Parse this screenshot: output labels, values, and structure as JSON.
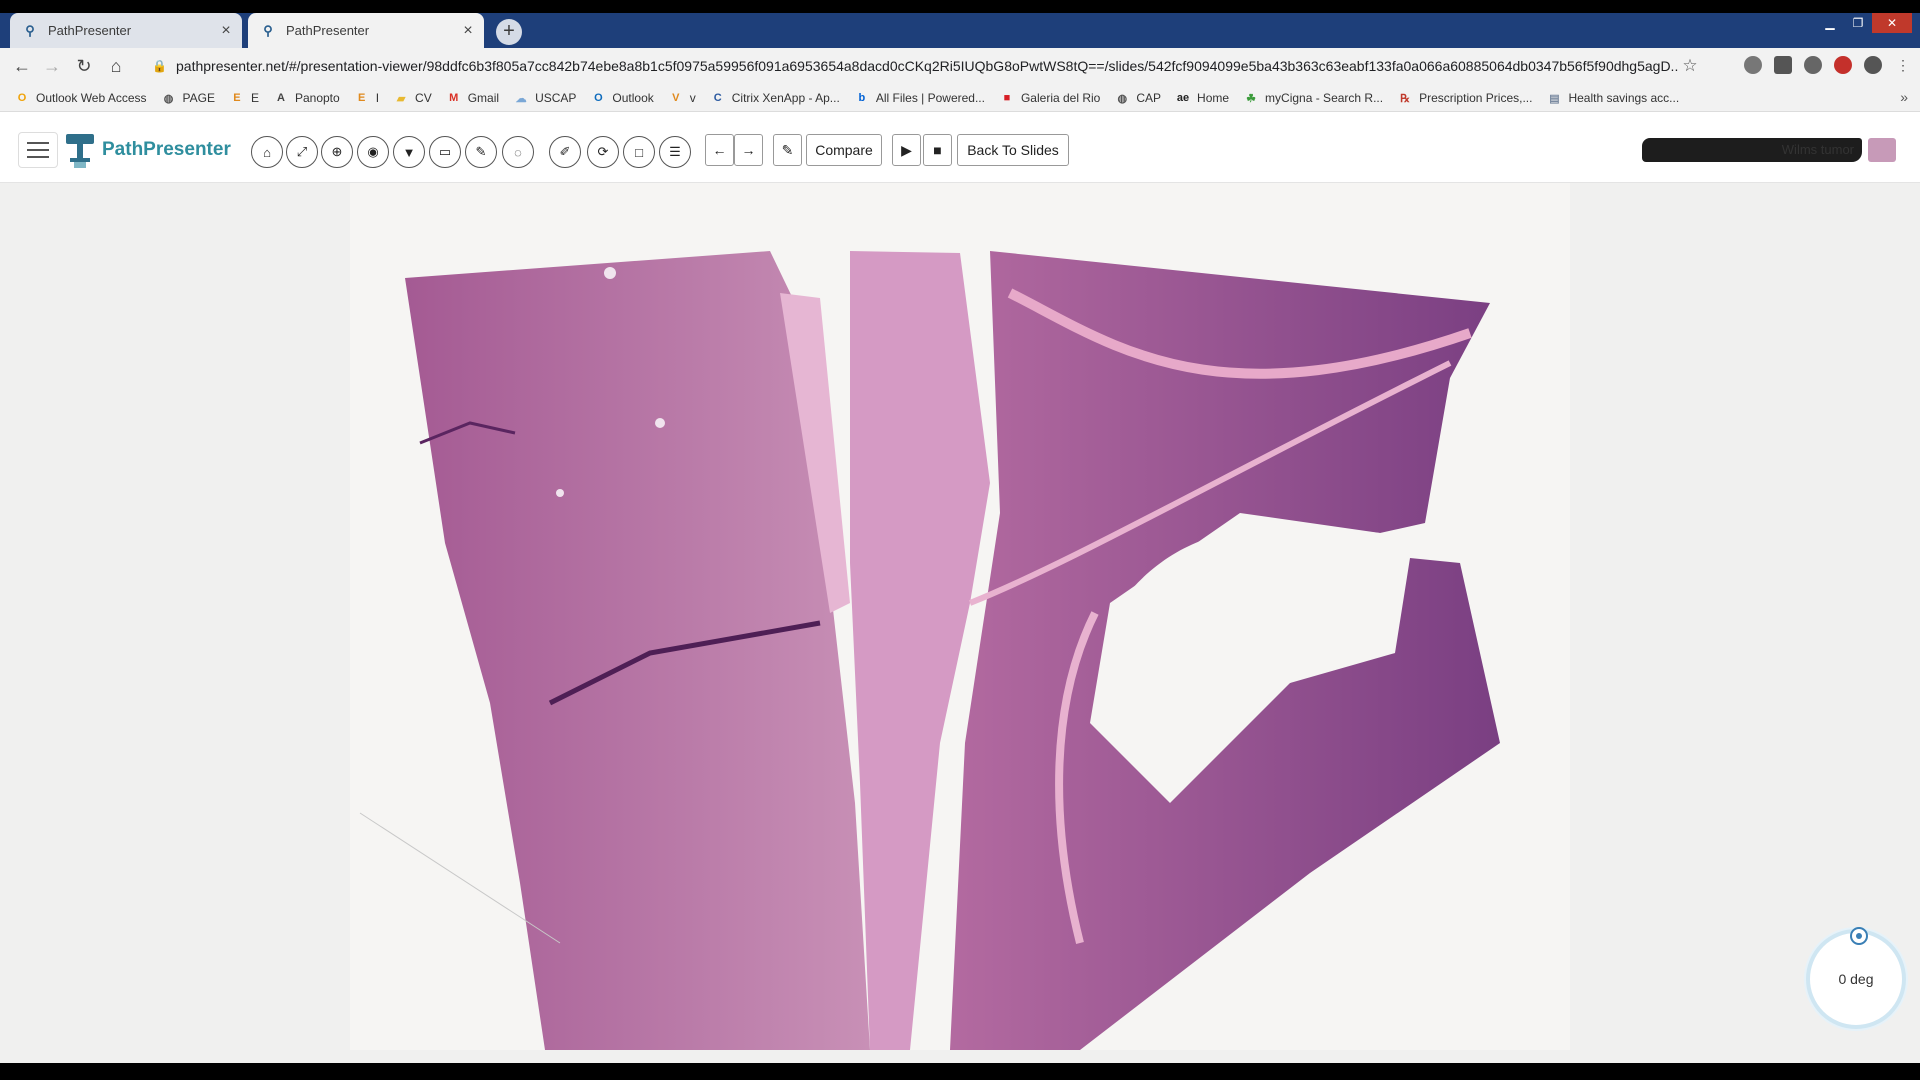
{
  "browser": {
    "tabs": [
      {
        "title": "PathPresenter",
        "active": false
      },
      {
        "title": "PathPresenter",
        "active": true
      }
    ],
    "url": "pathpresenter.net/#/presentation-viewer/98ddfc6b3f805a7cc842b74ebe8a8b1c5f0975a59956f091a6953654a8dacd0cCKq2Ri5IUQbG8oPwtWS8tQ==/slides/542fcf9094099e5ba43b363c63eabf133fa0a066a60885064db0347b56f5f90dhg5agD...",
    "bookmarks": [
      {
        "label": "Outlook Web Access",
        "icon": "outlook-icon",
        "color": "#f0a30a"
      },
      {
        "label": "PAGE",
        "icon": "globe-icon",
        "color": "#555555"
      },
      {
        "label": "E",
        "icon": "e-icon",
        "color": "#e08a1e"
      },
      {
        "label": "Panopto",
        "icon": "panopto-icon",
        "color": "#444444"
      },
      {
        "label": "I",
        "icon": "e-icon",
        "color": "#e08a1e"
      },
      {
        "label": "CV",
        "icon": "folder-icon",
        "color": "#e8b931"
      },
      {
        "label": "Gmail",
        "icon": "gmail-icon",
        "color": "#d93025"
      },
      {
        "label": "USCAP",
        "icon": "cloud-icon",
        "color": "#7aa7d6"
      },
      {
        "label": "Outlook",
        "icon": "outlook-icon",
        "color": "#0f6cbd"
      },
      {
        "label": "v",
        "icon": "v-icon",
        "color": "#e08a1e"
      },
      {
        "label": "Citrix XenApp - Ap...",
        "icon": "citrix-icon",
        "color": "#2c5aa0"
      },
      {
        "label": "All Files | Powered...",
        "icon": "box-icon",
        "color": "#0061d5"
      },
      {
        "label": "Galeria del Rio",
        "icon": "square-icon",
        "color": "#d71f26"
      },
      {
        "label": "CAP",
        "icon": "globe-icon",
        "color": "#555555"
      },
      {
        "label": "Home",
        "icon": "ae-icon",
        "color": "#222222"
      },
      {
        "label": "myCigna - Search R...",
        "icon": "cigna-icon",
        "color": "#3a9b3a"
      },
      {
        "label": "Prescription Prices,...",
        "icon": "rx-icon",
        "color": "#c0392b"
      },
      {
        "label": "Health savings acc...",
        "icon": "doc-icon",
        "color": "#7a8aa0"
      }
    ]
  },
  "app": {
    "name": "PathPresenter",
    "toolbar": {
      "compare_label": "Compare",
      "back_label": "Back To Slides"
    },
    "user": {
      "slide_label": "Wilms tumor"
    }
  },
  "viewer": {
    "rotation_label": "0 deg"
  }
}
